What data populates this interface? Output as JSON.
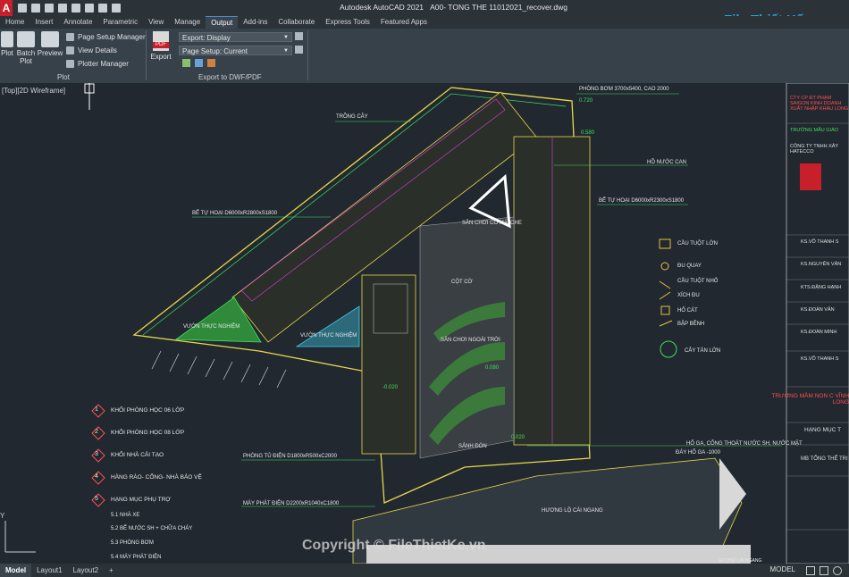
{
  "app": {
    "title": "Autodesk AutoCAD 2021",
    "file": "A00- TONG THE 11012021_recover.dwg",
    "logo_letter": "A"
  },
  "menu": {
    "tabs": [
      "Home",
      "Insert",
      "Annotate",
      "Parametric",
      "View",
      "Manage",
      "Output",
      "Add-ins",
      "Collaborate",
      "Express Tools",
      "Featured Apps"
    ],
    "active": "Output"
  },
  "ribbon": {
    "plot": "Plot",
    "batch_plot_1": "Batch",
    "batch_plot_2": "Plot",
    "preview": "Preview",
    "page_setup_manager": "Page Setup Manager",
    "view_details": "View Details",
    "plotter_manager": "Plotter Manager",
    "plot_panel": "Plot",
    "export_label": "Export",
    "export_display": "Export: Display",
    "page_setup_current": "Page Setup: Current",
    "export_panel": "Export to DWF/PDF",
    "pdf_badge": "PDF"
  },
  "viewport": {
    "label": "[Top][2D Wireframe]"
  },
  "legend": [
    {
      "num": "1",
      "text": "KHỐI PHÒNG HỌC 06 LỚP"
    },
    {
      "num": "2",
      "text": "KHỐI PHÒNG HỌC 08 LỚP"
    },
    {
      "num": "3",
      "text": "KHỐI NHÀ CẢI TẠO"
    },
    {
      "num": "4",
      "text": "HÀNG RÀO- CỔNG- NHÀ BẢO VỆ"
    },
    {
      "num": "5",
      "text": "HẠNG MỤC PHỤ TRỢ"
    }
  ],
  "sub_items": [
    "5.1 NHÀ XE",
    "5.2 BỂ NƯỚC SH + CHỮA CHÁY",
    "5.3 PHÒNG BƠM",
    "5.4 MÁY PHÁT ĐIỆN"
  ],
  "symbols": [
    "CẦU TUỘT LỚN",
    "ĐU QUAY",
    "CẦU TUỘT NHỎ",
    "XÍCH ĐU",
    "HỐ CÁT",
    "BẬP BÊNH",
    "CÂY TÁN LỚN"
  ],
  "annotations": {
    "phong_bom": "PHÒNG BƠM 3700x5400, CAO 2000",
    "trong_cay": "TRỒNG CÂY",
    "ho_nuoc": "HỒ NƯỚC CAN",
    "be_tu_hoai_1": "BỂ TỰ HOẠI D6000xR2800xS1800",
    "be_tu_hoai_2": "BỂ TỰ HOẠI D6000xR2300xS1800",
    "san_choi_co": "SÂN CHƠI CÓ MÁI CHE",
    "cot_co": "CỘT CỜ",
    "vuon_1": "VƯỜN THỰC NGHIỆM",
    "vuon_2": "VƯỜN THỰC NGHIỆM",
    "san_choi_ngoai": "SÂN CHƠI NGOÀI TRỜI",
    "sanh_don": "SẢNH ĐÓN",
    "phong_tu_dien": "PHÒNG TỦ ĐIỆN D1800xR500xC2000",
    "may_phat": "MÁY PHÁT ĐIỆN D2200xR1040xC1800",
    "ho_ga": "HỐ GA, CỐNG THOÁT NƯỚC SH, NƯỚC MẶT",
    "day_ho_ga": "ĐÁY HỐ GA -1000",
    "huong_lo": "HƯƠNG LỘ CÁI NGANG",
    "di_cho": "ĐI CHỢ CÁI NGANG",
    "level_1": "0.720",
    "level_2": "0.580",
    "level_3": "-0.020",
    "level_4": "0.020",
    "level_5": "0.080"
  },
  "titleblock": {
    "company": "CTY CP ĐT PHẠM SAIGON KINH DOANH XUẤT NHẬP KHẨU LONG",
    "owner": "TRƯỜNG MẪU GIÁO",
    "firm": "CÔNG TY TNHH XÂY HATECCO",
    "roles": [
      "KS.VÕ THANH S",
      "KS.NGUYỄN VĂN",
      "KTS.ĐẶNG HẠNH",
      "KS.ĐOÀN VĂN",
      "KS.ĐOÀN MINH",
      "KS.VÕ THANH S"
    ],
    "project": "TRƯỜNG MẦM NON C VĨNH LONG",
    "item": "HẠNG MỤC T",
    "sheet": "MB TỔNG THỂ TRI"
  },
  "status": {
    "tabs": [
      "Model",
      "Layout1",
      "Layout2"
    ],
    "active": "Model",
    "add": "+",
    "mode": "MODEL"
  },
  "watermark": "Copyright © FileThietKe.vn",
  "brand": "File Thiết Kế.vn",
  "colors": {
    "canvas": "#212830",
    "ribbon": "#37414a",
    "line_yellow": "#e8d84a",
    "line_magenta": "#e040e0",
    "line_green": "#40e060",
    "line_cyan": "#40c8e8"
  }
}
